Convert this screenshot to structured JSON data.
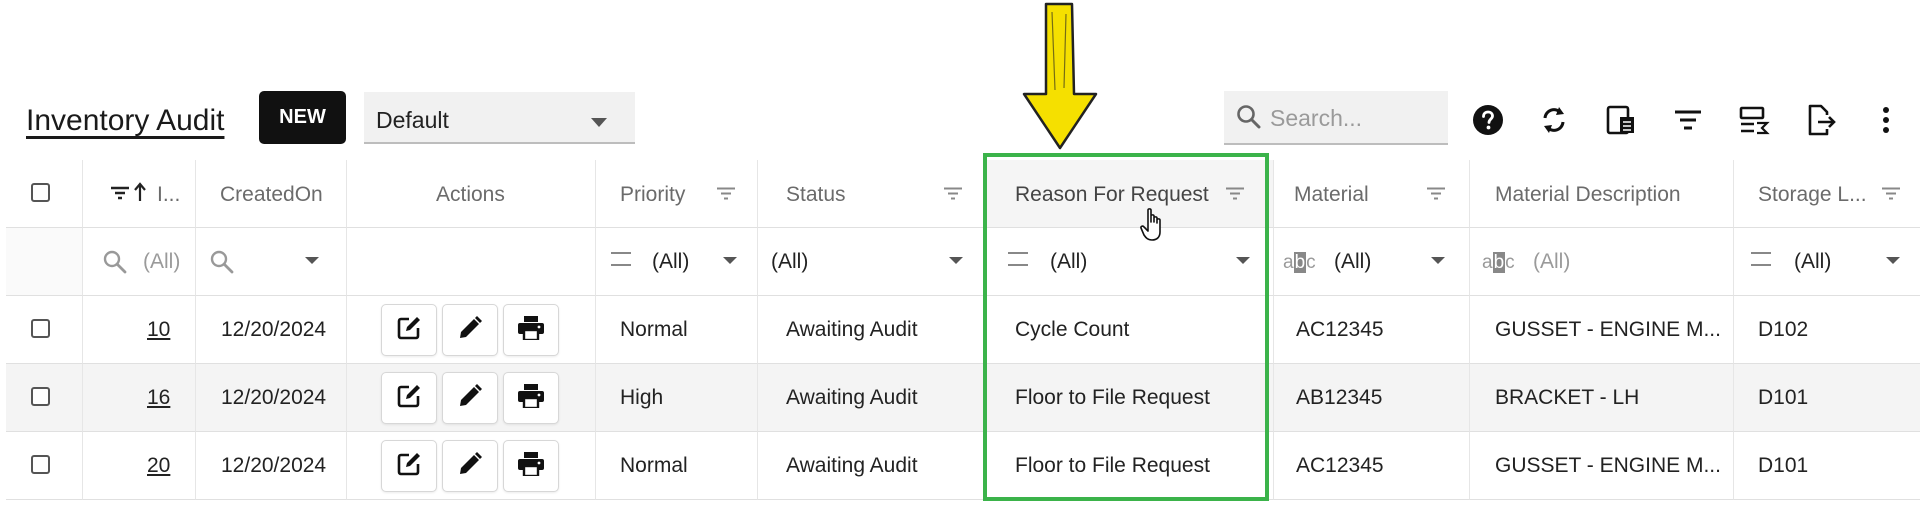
{
  "toolbar": {
    "title": "Inventory Audit",
    "new_label": "NEW",
    "view_value": "Default",
    "search_placeholder": "Search...",
    "icons": [
      "help-icon",
      "refresh-icon",
      "column-chooser-icon",
      "filter-icon",
      "summary-icon",
      "export-icon",
      "more-icon"
    ]
  },
  "columns": {
    "id": "I...",
    "created_on": "CreatedOn",
    "actions": "Actions",
    "priority": "Priority",
    "status": "Status",
    "reason": "Reason For Request",
    "material": "Material",
    "material_description": "Material Description",
    "storage": "Storage L..."
  },
  "filters": {
    "id": "(All)",
    "priority": "(All)",
    "status": "(All)",
    "reason": "(All)",
    "material": "(All)",
    "material_description": "(All)",
    "storage": "(All)"
  },
  "rows": [
    {
      "id": "10",
      "created_on": "12/20/2024",
      "priority": "Normal",
      "status": "Awaiting Audit",
      "reason": "Cycle Count",
      "material": "AC12345",
      "material_description": "GUSSET - ENGINE M...",
      "storage": "D102"
    },
    {
      "id": "16",
      "created_on": "12/20/2024",
      "priority": "High",
      "status": "Awaiting Audit",
      "reason": "Floor to File Request",
      "material": "AB12345",
      "material_description": "BRACKET - LH",
      "storage": "D101"
    },
    {
      "id": "20",
      "created_on": "12/20/2024",
      "priority": "Normal",
      "status": "Awaiting Audit",
      "reason": "Floor to File Request",
      "material": "AC12345",
      "material_description": "GUSSET - ENGINE M...",
      "storage": "D101"
    }
  ],
  "colors": {
    "highlight": "#3bb34a",
    "arrow": "#f5e000"
  }
}
